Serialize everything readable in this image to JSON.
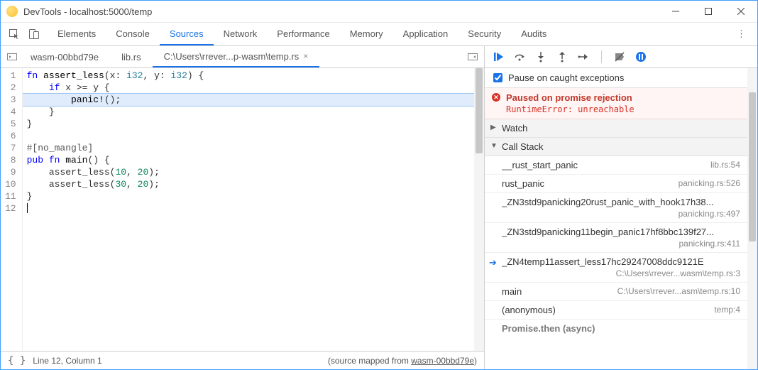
{
  "window": {
    "title": "DevTools - localhost:5000/temp"
  },
  "main_tabs": [
    "Elements",
    "Console",
    "Sources",
    "Network",
    "Performance",
    "Memory",
    "Application",
    "Security",
    "Audits"
  ],
  "active_main_tab": 2,
  "file_tabs": [
    {
      "label": "wasm-00bbd79e",
      "active": false
    },
    {
      "label": "lib.rs",
      "active": false
    },
    {
      "label": "C:\\Users\\rrever...p-wasm\\temp.rs",
      "active": true
    }
  ],
  "code_lines": [
    {
      "n": 1,
      "html": "<span class='tok-kw'>fn</span> <span class='tok-fn'>assert_less</span>(x: <span class='tok-type'>i32</span>, y: <span class='tok-type'>i32</span>) {"
    },
    {
      "n": 2,
      "html": "    <span class='tok-kw'>if</span> x &gt;= y {"
    },
    {
      "n": 3,
      "html": "        <span class='tok-macro'>panic!</span>();",
      "hl": true
    },
    {
      "n": 4,
      "html": "    }"
    },
    {
      "n": 5,
      "html": "}"
    },
    {
      "n": 6,
      "html": ""
    },
    {
      "n": 7,
      "html": "<span class='tok-attr'>#[no_mangle]</span>"
    },
    {
      "n": 8,
      "html": "<span class='tok-kw'>pub fn</span> <span class='tok-fn'>main</span>() {"
    },
    {
      "n": 9,
      "html": "    assert_less(<span class='tok-num'>10</span>, <span class='tok-num'>20</span>);"
    },
    {
      "n": 10,
      "html": "    assert_less(<span class='tok-num'>30</span>, <span class='tok-num'>20</span>);"
    },
    {
      "n": 11,
      "html": "}"
    },
    {
      "n": 12,
      "html": "<span class='cursor-caret'></span>"
    }
  ],
  "status": {
    "pos": "Line 12, Column 1",
    "map_prefix": "(source mapped from ",
    "map_link": "wasm-00bbd79e",
    "map_suffix": ")"
  },
  "debugger": {
    "pause_checkbox_label": "Pause on caught exceptions",
    "paused_title": "Paused on promise rejection",
    "paused_detail": "RuntimeError: unreachable",
    "sections": {
      "watch": "Watch",
      "callstack": "Call Stack"
    },
    "call_stack": [
      {
        "fn": "__rust_start_panic",
        "loc": "lib.rs:54"
      },
      {
        "fn": "rust_panic",
        "loc": "panicking.rs:526"
      },
      {
        "fn": "_ZN3std9panicking20rust_panic_with_hook17h38...",
        "loc": "panicking.rs:497",
        "two": true
      },
      {
        "fn": "_ZN3std9panicking11begin_panic17hf8bbc139f27...",
        "loc": "panicking.rs:411",
        "two": true
      },
      {
        "fn": "_ZN4temp11assert_less17hc29247008ddc9121E",
        "loc": "C:\\Users\\rrever...wasm\\temp.rs:3",
        "two": true,
        "current": true
      },
      {
        "fn": "main",
        "loc": "C:\\Users\\rrever...asm\\temp.rs:10"
      },
      {
        "fn": "(anonymous)",
        "loc": "temp:4"
      }
    ],
    "async_label": "Promise.then (async)"
  }
}
